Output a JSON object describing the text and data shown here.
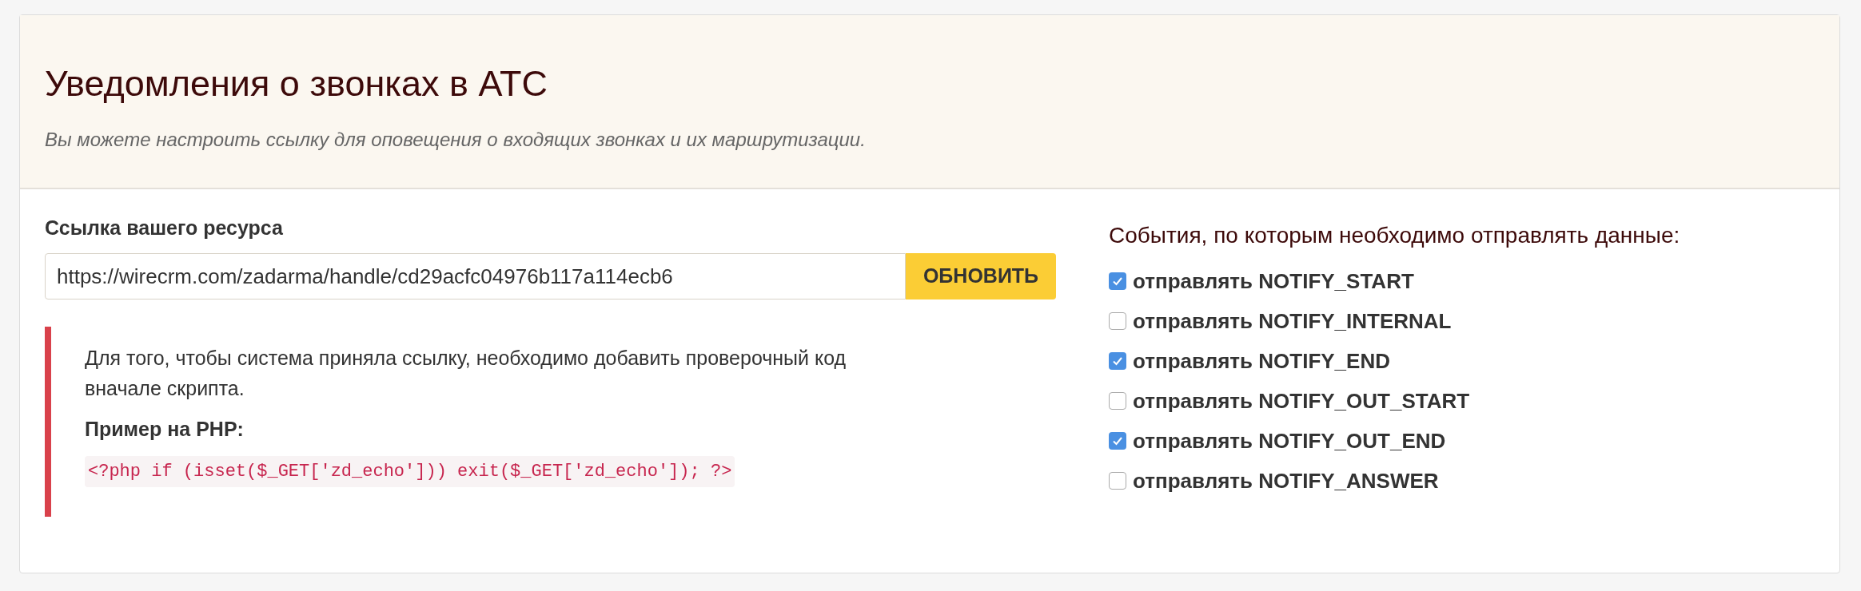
{
  "header": {
    "title": "Уведомления о звонках в АТС",
    "subtitle": "Вы можете настроить ссылку для оповещения о входящих звонках и их маршрутизации."
  },
  "link": {
    "label": "Ссылка вашего ресурса",
    "value": "https://wirecrm.com/zadarma/handle/cd29acfc04976b117a114ecb6",
    "button": "ОБНОВИТЬ"
  },
  "note": {
    "text": "Для того, чтобы система приняла ссылку, необходимо добавить проверочный код вначале скрипта.",
    "example_label": "Пример на PHP:",
    "code": "<?php if (isset($_GET['zd_echo'])) exit($_GET['zd_echo']); ?>"
  },
  "events": {
    "heading": "События, по которым необходимо отправлять данные:",
    "items": [
      {
        "label": "отправлять NOTIFY_START",
        "checked": true
      },
      {
        "label": "отправлять NOTIFY_INTERNAL",
        "checked": false
      },
      {
        "label": "отправлять NOTIFY_END",
        "checked": true
      },
      {
        "label": "отправлять NOTIFY_OUT_START",
        "checked": false
      },
      {
        "label": "отправлять NOTIFY_OUT_END",
        "checked": true
      },
      {
        "label": "отправлять NOTIFY_ANSWER",
        "checked": false
      }
    ]
  }
}
